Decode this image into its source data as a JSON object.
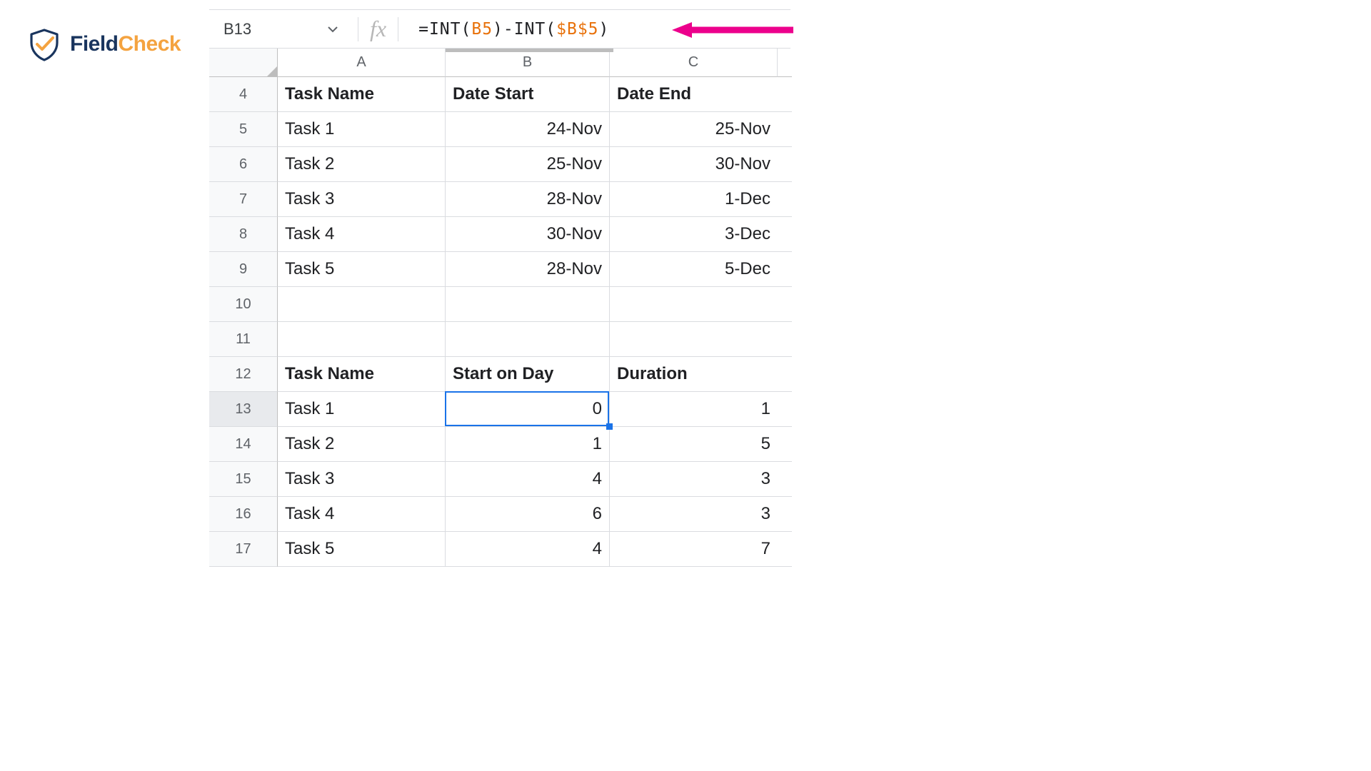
{
  "logo": {
    "text1": "Field",
    "text2": "Check"
  },
  "formula_bar": {
    "cell_ref": "B13",
    "fx_label": "fx",
    "formula_parts": {
      "p1": "=INT(",
      "ref1": "B5",
      "p2": ")-INT(",
      "ref2": "$B$5",
      "p3": ")"
    }
  },
  "columns": [
    "A",
    "B",
    "C"
  ],
  "rows": [
    {
      "num": "4",
      "A": "Task Name",
      "B": "Date Start",
      "C": "Date End",
      "header": true
    },
    {
      "num": "5",
      "A": "Task 1",
      "B": "24-Nov",
      "C": "25-Nov"
    },
    {
      "num": "6",
      "A": "Task 2",
      "B": "25-Nov",
      "C": "30-Nov"
    },
    {
      "num": "7",
      "A": "Task 3",
      "B": "28-Nov",
      "C": "1-Dec"
    },
    {
      "num": "8",
      "A": "Task 4",
      "B": "30-Nov",
      "C": "3-Dec"
    },
    {
      "num": "9",
      "A": "Task 5",
      "B": "28-Nov",
      "C": "5-Dec"
    },
    {
      "num": "10",
      "A": "",
      "B": "",
      "C": ""
    },
    {
      "num": "11",
      "A": "",
      "B": "",
      "C": ""
    },
    {
      "num": "12",
      "A": "Task Name",
      "B": "Start on Day",
      "C": "Duration",
      "header": true,
      "balign_left": true
    },
    {
      "num": "13",
      "A": "Task 1",
      "B": "0",
      "C": "1",
      "active": true
    },
    {
      "num": "14",
      "A": "Task 2",
      "B": "1",
      "C": "5"
    },
    {
      "num": "15",
      "A": "Task 3",
      "B": "4",
      "C": "3"
    },
    {
      "num": "16",
      "A": "Task 4",
      "B": "6",
      "C": "3"
    },
    {
      "num": "17",
      "A": "Task 5",
      "B": "4",
      "C": "7"
    }
  ],
  "selection": {
    "cell": "B13"
  },
  "colors": {
    "accent": "#1a73e8",
    "annotation": "#ec008c"
  },
  "chart_data": {
    "type": "table",
    "title": "Task schedule with computed Start on Day and Duration",
    "tables": [
      {
        "name": "dates",
        "columns": [
          "Task Name",
          "Date Start",
          "Date End"
        ],
        "rows": [
          [
            "Task 1",
            "24-Nov",
            "25-Nov"
          ],
          [
            "Task 2",
            "25-Nov",
            "30-Nov"
          ],
          [
            "Task 3",
            "28-Nov",
            "1-Dec"
          ],
          [
            "Task 4",
            "30-Nov",
            "3-Dec"
          ],
          [
            "Task 5",
            "28-Nov",
            "5-Dec"
          ]
        ]
      },
      {
        "name": "offsets",
        "columns": [
          "Task Name",
          "Start on Day",
          "Duration"
        ],
        "rows": [
          [
            "Task 1",
            0,
            1
          ],
          [
            "Task 2",
            1,
            5
          ],
          [
            "Task 3",
            4,
            3
          ],
          [
            "Task 4",
            6,
            3
          ],
          [
            "Task 5",
            4,
            7
          ]
        ]
      }
    ]
  }
}
